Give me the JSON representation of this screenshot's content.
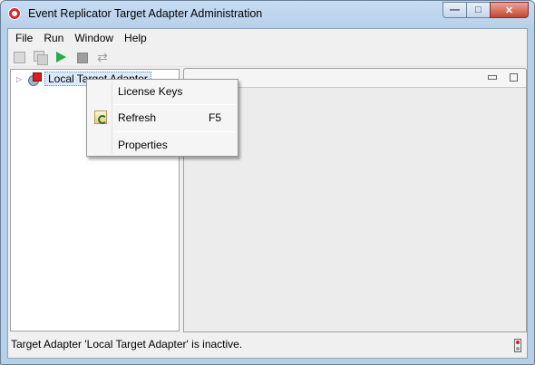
{
  "window": {
    "title": "Event Replicator Target Adapter Administration",
    "controls": {
      "minimize": "—",
      "maximize": "□",
      "close": "✕"
    }
  },
  "menubar": {
    "items": [
      "File",
      "Run",
      "Window",
      "Help"
    ]
  },
  "toolbar": {
    "icons": [
      "save-icon",
      "save-all-icon",
      "run-icon",
      "stop-icon",
      "sync-icon"
    ],
    "sync_glyph": "⇄"
  },
  "tree": {
    "root": {
      "label": "Local Target Adapter",
      "expand_glyph": "▷",
      "icon": "target-adapter-icon"
    }
  },
  "context_menu": {
    "items": [
      {
        "label": "License Keys",
        "shortcut": ""
      },
      {
        "label": "Refresh",
        "shortcut": "F5",
        "icon": "refresh-icon"
      },
      {
        "label": "Properties",
        "shortcut": ""
      }
    ]
  },
  "status": {
    "text": "Target Adapter 'Local Target Adapter' is inactive.",
    "indicator": "status-indicator-icon"
  },
  "colors": {
    "title_bar": "#c6dcf2",
    "close_button": "#c74530",
    "run_green": "#2ea84a",
    "adapter_red": "#d52020",
    "selection": "#dbe9f8"
  }
}
